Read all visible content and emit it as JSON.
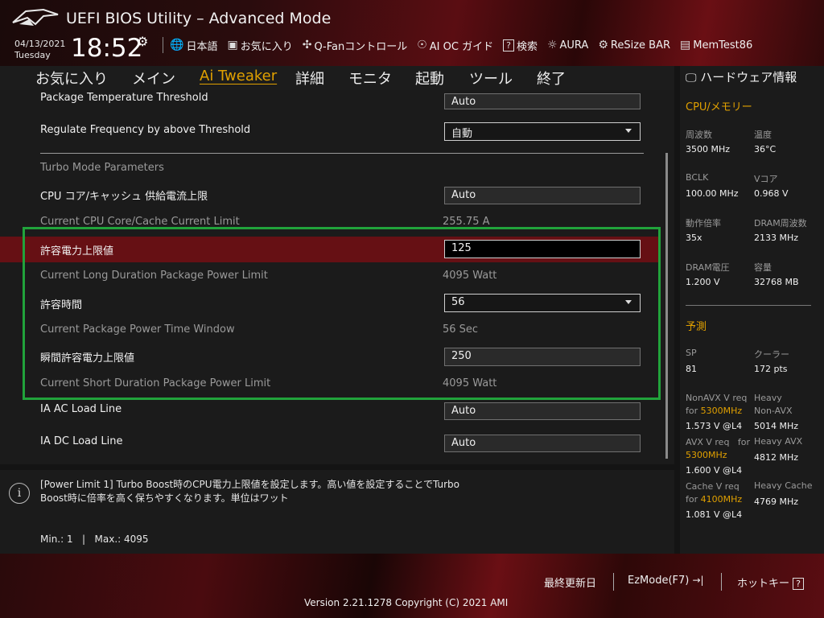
{
  "app": {
    "title": "UEFI BIOS Utility – Advanced Mode"
  },
  "clock": {
    "date": "04/13/2021",
    "day": "Tuesday",
    "time": "18:52"
  },
  "toolbar": [
    {
      "icon": "globe-icon",
      "glyph": "🌐",
      "label": "日本語"
    },
    {
      "icon": "favorites-icon",
      "glyph": "▣",
      "label": "お気に入り"
    },
    {
      "icon": "fan-icon",
      "glyph": "✣",
      "label": "Q-Fanコントロール"
    },
    {
      "icon": "ai-oc-icon",
      "glyph": "☉",
      "label": "AI OC ガイド"
    },
    {
      "icon": "search-icon",
      "glyph": "?",
      "label": "検索"
    },
    {
      "icon": "aura-icon",
      "glyph": "☼",
      "label": "AURA"
    },
    {
      "icon": "resize-bar-icon",
      "glyph": "⚙",
      "label": "ReSize BAR"
    },
    {
      "icon": "memtest-icon",
      "glyph": "▤",
      "label": "MemTest86"
    }
  ],
  "menu": [
    "お気に入り",
    "メイン",
    "Ai Tweaker",
    "詳細",
    "モニタ",
    "起動",
    "ツール",
    "終了"
  ],
  "settings": {
    "pkg_temp_threshold": {
      "label": "Package Temperature Threshold",
      "value": "Auto"
    },
    "regulate_freq": {
      "label": "Regulate Frequency by above Threshold",
      "value": "自動"
    },
    "turbo_header": "Turbo Mode Parameters",
    "cpu_core_cache_limit": {
      "label": "CPU コア/キャッシュ 供給電流上限",
      "value": "Auto"
    },
    "current_core_cache_limit": {
      "label": "Current CPU Core/Cache Current Limit",
      "value": "255.75 A"
    },
    "power_limit": {
      "label": "許容電力上限値",
      "value": "125"
    },
    "current_long_duration": {
      "label": "Current Long Duration Package Power Limit",
      "value": "4095 Watt"
    },
    "time_window": {
      "label": "許容時間",
      "value": "56"
    },
    "current_time_window": {
      "label": "Current Package Power Time Window",
      "value": "56 Sec"
    },
    "short_power_limit": {
      "label": "瞬間許容電力上限値",
      "value": "250"
    },
    "current_short_duration": {
      "label": "Current Short Duration Package Power Limit",
      "value": "4095 Watt"
    },
    "ia_ac_load_line": {
      "label": "IA AC Load Line",
      "value": "Auto"
    },
    "ia_dc_load_line": {
      "label": "IA DC Load Line",
      "value": "Auto"
    }
  },
  "help": {
    "line1": "[Power Limit 1] Turbo Boost時のCPU電力上限値を設定します。高い値を設定することでTurbo",
    "line2": "Boost時に倍率を高く保ちやすくなります。単位はワット",
    "minmax": "Min.: 1   |   Max.: 4095"
  },
  "hw": {
    "title": "ハードウェア情報",
    "cpu_mem": "CPU/メモリー",
    "freq_label": "周波数",
    "freq": "3500 MHz",
    "temp_label": "温度",
    "temp": "36°C",
    "bclk_label": "BCLK",
    "bclk": "100.00 MHz",
    "vcore_label": "Vコア",
    "vcore": "0.968 V",
    "ratio_label": "動作倍率",
    "ratio": "35x",
    "dram_freq_label": "DRAM周波数",
    "dram_freq": "2133 MHz",
    "dram_volt_label": "DRAM電圧",
    "dram_volt": "1.200 V",
    "capacity_label": "容量",
    "capacity": "32768 MB",
    "predict": "予測",
    "sp_label": "SP",
    "sp": "81",
    "cooler_label": "クーラー",
    "cooler": "172 pts",
    "nonavx_req_a": "NonAVX V req",
    "nonavx_req_b": "for ",
    "nonavx_req_mhz": "5300MHz",
    "nonavx_v": "1.573 V @L4",
    "heavy_nonavx_a": "Heavy",
    "heavy_nonavx_b": "Non-AVX",
    "heavy_nonavx": "5014 MHz",
    "avx_req_a": "AVX V req   for",
    "avx_req_mhz": "5300MHz",
    "avx_v": "1.600 V @L4",
    "heavy_avx_label": "Heavy AVX",
    "heavy_avx": "4812 MHz",
    "cache_req_a": "Cache V req",
    "cache_req_b": "for ",
    "cache_req_mhz": "4100MHz",
    "cache_v": "1.081 V @L4",
    "heavy_cache_label": "Heavy Cache",
    "heavy_cache": "4769 MHz"
  },
  "footer": {
    "last_modified": "最終更新日",
    "ezmode": "EzMode(F7)",
    "ezmode_icon": "→|",
    "hotkey": "ホットキー",
    "hotkey_icon": "?",
    "version": "Version 2.21.1278 Copyright (C) 2021 AMI"
  }
}
